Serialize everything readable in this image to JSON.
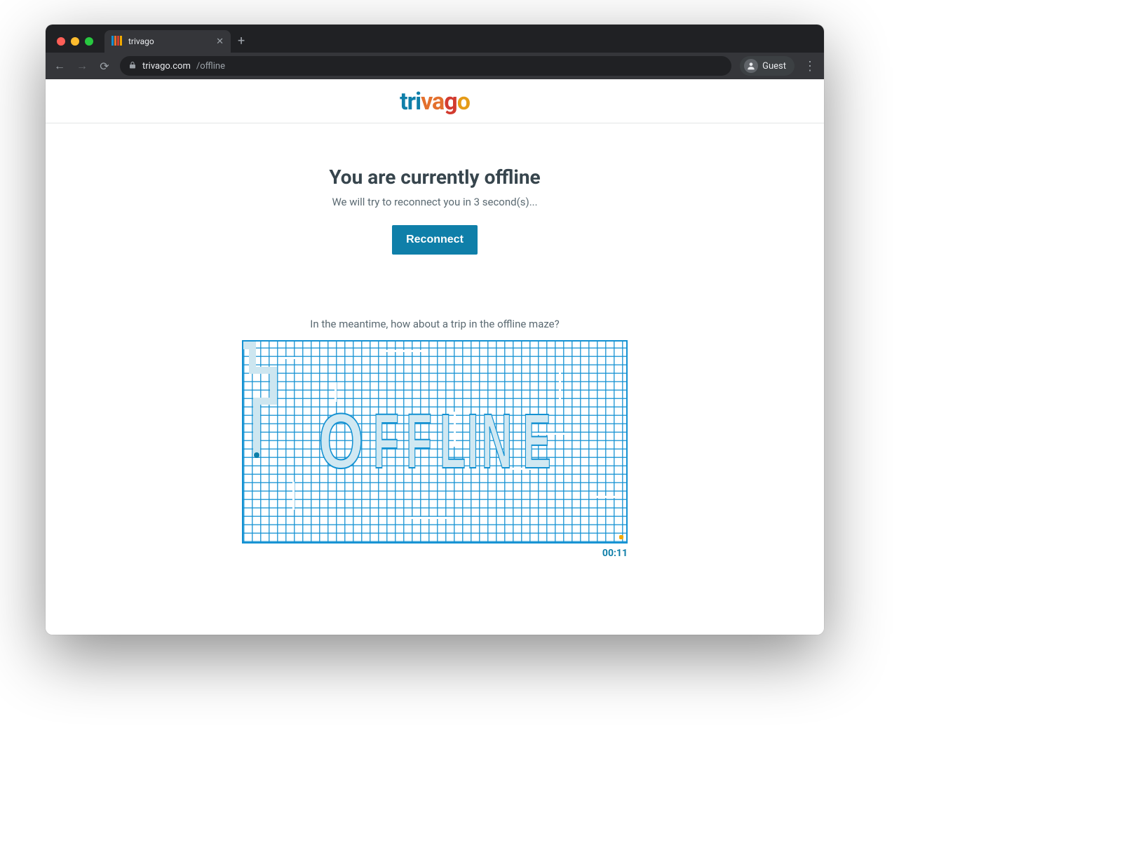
{
  "browser": {
    "tab_title": "trivago",
    "url_domain": "trivago.com",
    "url_path": "/offline",
    "guest_label": "Guest"
  },
  "logo": {
    "part1": "tri",
    "part2": "va",
    "part3": "g",
    "part4": "o"
  },
  "offline": {
    "title": "You are currently offline",
    "message": "We will try to reconnect you in 3 second(s)...",
    "button": "Reconnect"
  },
  "maze": {
    "intro": "In the meantime, how about a trip in the offline maze?",
    "word": "OFFLINE",
    "timer": "00:11"
  }
}
